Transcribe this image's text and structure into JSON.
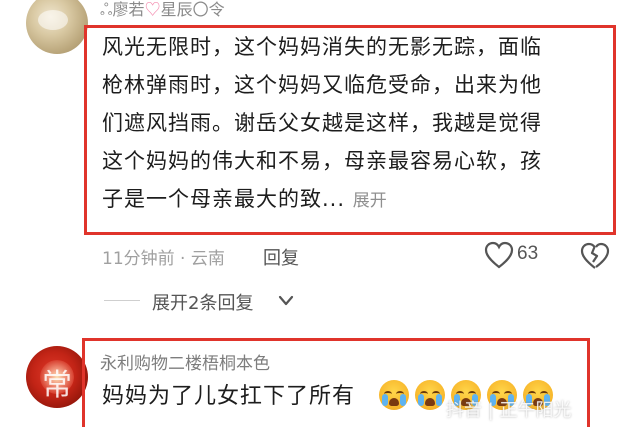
{
  "comments": [
    {
      "username": "ஃ廖若",
      "username_suffix": "星辰〇令",
      "lines": [
        "风光无限时，这个妈妈消失的无影无踪，面临",
        "枪林弹雨时，这个妈妈又临危受命，出来为他",
        "们遮风挡雨。谢岳父女越是这样，我越是觉得",
        "这个妈妈的伟大和不易，母亲最容易心软，孩",
        "子是一个母亲最大的致..."
      ],
      "expand_label": "展开",
      "meta": "11分钟前 · 云南",
      "reply_label": "回复",
      "like_count": "63",
      "replies_label": "展开2条回复"
    },
    {
      "username": "永利购物二楼梧桐本色",
      "text": "妈妈为了儿女扛下了所有",
      "avatar_glyph": "常",
      "emoji_count": 5
    }
  ],
  "watermark": "抖音 | 正午阳光",
  "colors": {
    "highlight_border": "#e0342b",
    "meta_gray": "#a0a0a0"
  }
}
